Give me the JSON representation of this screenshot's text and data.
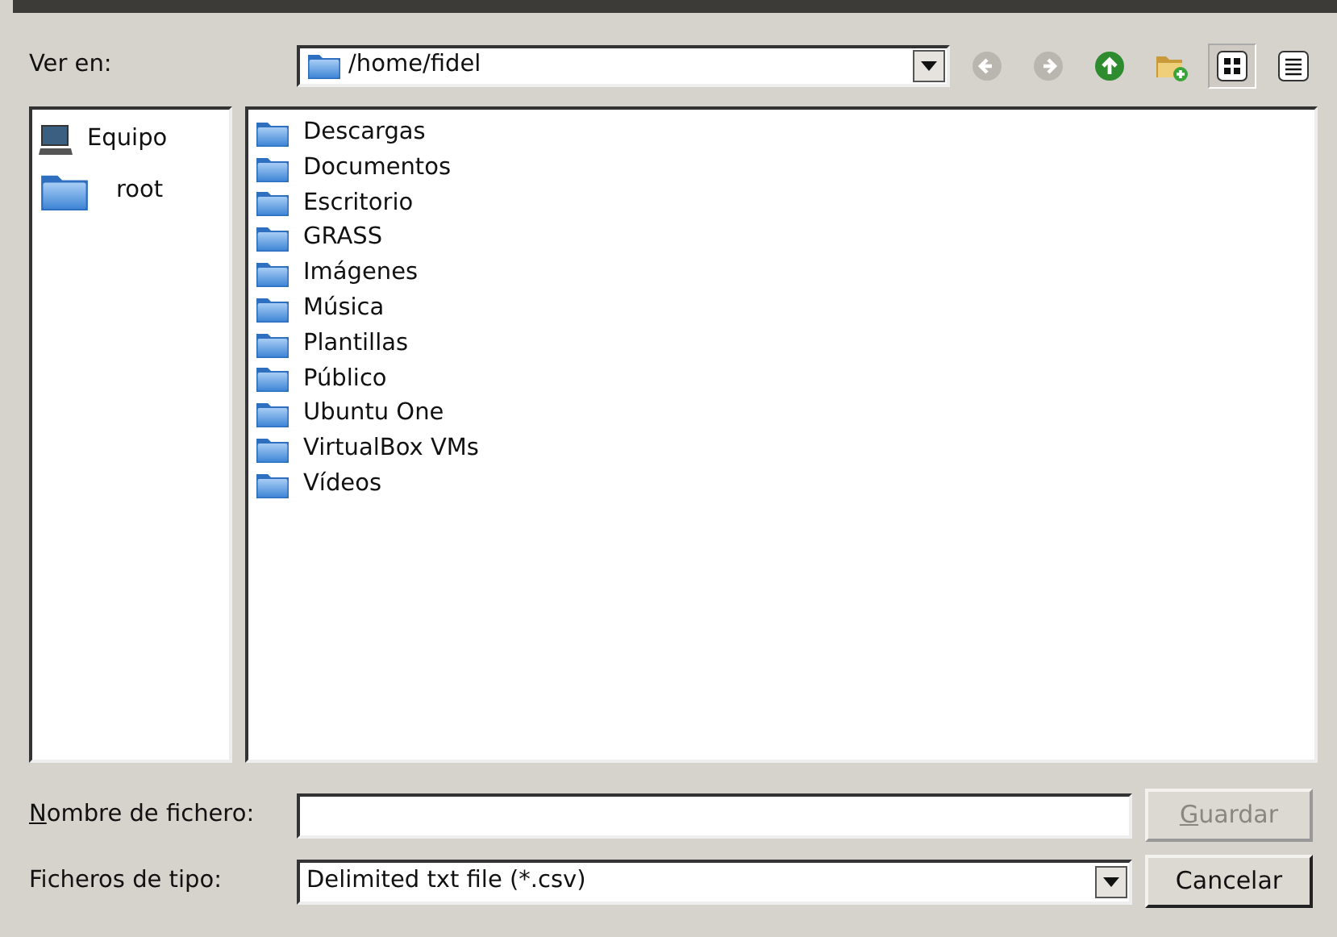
{
  "look_in": {
    "label": "Ver en:",
    "path": "/home/fidel"
  },
  "toolbar": [
    {
      "kind": "back",
      "disabled": true
    },
    {
      "kind": "forward",
      "disabled": true
    },
    {
      "kind": "up",
      "disabled": false
    },
    {
      "kind": "new-folder"
    },
    {
      "kind": "icon-view",
      "selected": true
    },
    {
      "kind": "list-view",
      "selected": false
    }
  ],
  "sidebar": {
    "items": [
      {
        "kind": "computer",
        "label": "Equipo"
      },
      {
        "kind": "folder",
        "label": "root"
      }
    ]
  },
  "files": [
    {
      "name": "Descargas"
    },
    {
      "name": "Documentos"
    },
    {
      "name": "Escritorio"
    },
    {
      "name": "GRASS"
    },
    {
      "name": "Imágenes"
    },
    {
      "name": "Música"
    },
    {
      "name": "Plantillas"
    },
    {
      "name": "Público"
    },
    {
      "name": "Ubuntu One"
    },
    {
      "name": "VirtualBox VMs"
    },
    {
      "name": "Vídeos"
    }
  ],
  "filename": {
    "label": "Nombre de fichero:",
    "label_underline_first": true
  },
  "filetype": {
    "label": "Ficheros de tipo:",
    "value": "Delimited txt file (*.csv)"
  },
  "buttons": [
    {
      "label": "Guardar",
      "underline_first": true,
      "disabled": true
    },
    {
      "label": "Cancelar",
      "underline_first": false,
      "disabled": false
    }
  ]
}
